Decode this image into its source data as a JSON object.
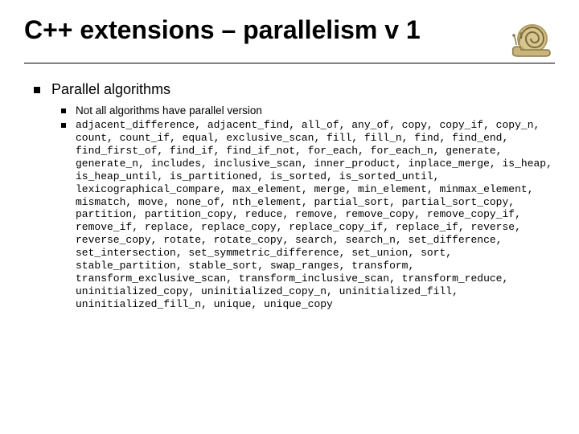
{
  "title": "C++ extensions – parallelism v 1",
  "level1": "Parallel algorithms",
  "sub1": "Not all algorithms have parallel version",
  "algorithms": "adjacent_difference, adjacent_find, all_of, any_of, copy, copy_if, copy_n, count, count_if, equal, exclusive_scan, fill, fill_n, find, find_end, find_first_of, find_if, find_if_not, for_each, for_each_n, generate, generate_n, includes, inclusive_scan, inner_product, inplace_merge, is_heap, is_heap_until, is_partitioned, is_sorted, is_sorted_until, lexicographical_compare, max_element, merge, min_element, minmax_element, mismatch, move, none_of, nth_element, partial_sort, partial_sort_copy, partition, partition_copy, reduce, remove, remove_copy, remove_copy_if, remove_if, replace, replace_copy, replace_copy_if, replace_if, reverse, reverse_copy, rotate, rotate_copy, search, search_n, set_difference, set_intersection, set_symmetric_difference, set_union, sort, stable_partition, stable_sort, swap_ranges, transform, transform_exclusive_scan, transform_inclusive_scan, transform_reduce, uninitialized_copy, uninitialized_copy_n, uninitialized_fill, uninitialized_fill_n, unique, unique_copy"
}
